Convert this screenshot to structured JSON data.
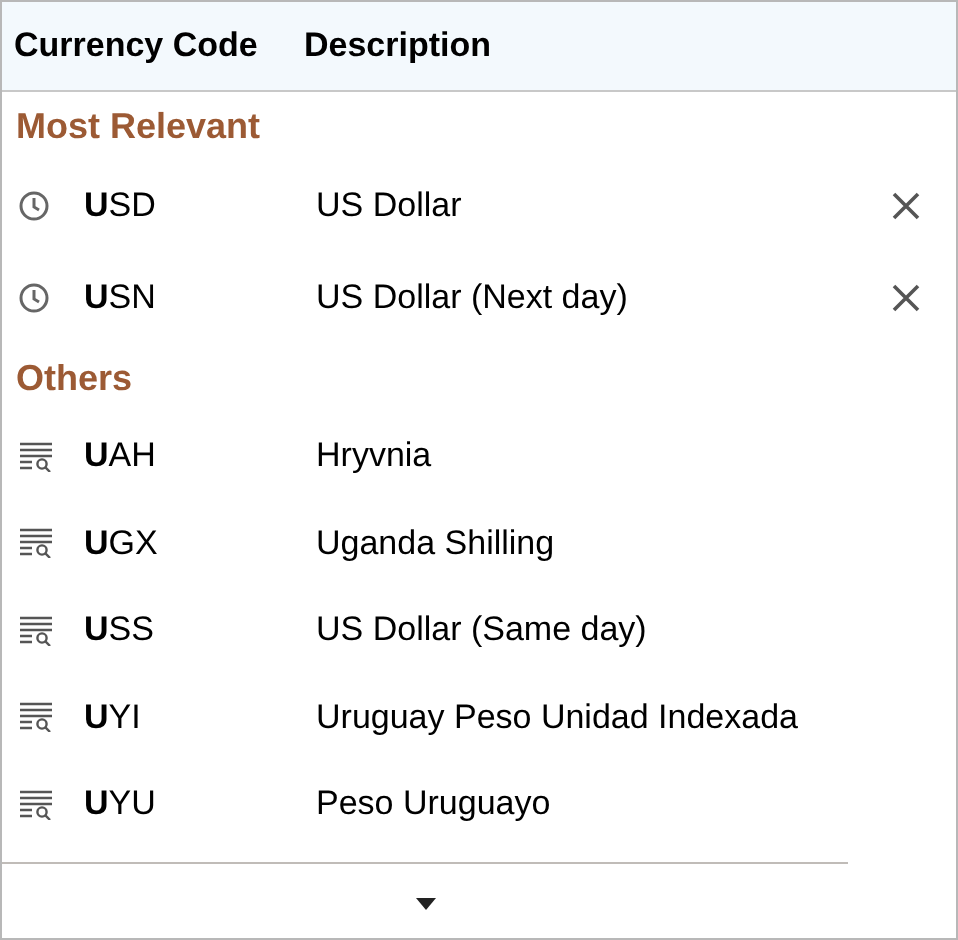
{
  "columns": [
    "Currency Code",
    "Description"
  ],
  "groups": [
    {
      "title": "Most Relevant",
      "items": [
        {
          "kind": "recent",
          "code": "**U**SD",
          "description": "US Dollar"
        },
        {
          "kind": "recent",
          "code": "**U**SN",
          "description": "US Dollar (Next day)"
        }
      ]
    },
    {
      "title": "Others",
      "items": [
        {
          "kind": "result",
          "code": "**U**AH",
          "description": "Hryvnia"
        },
        {
          "kind": "result",
          "code": "**U**GX",
          "description": "Uganda Shilling"
        },
        {
          "kind": "result",
          "code": "**U**SS",
          "description": "US Dollar (Same day)"
        },
        {
          "kind": "result",
          "code": "**U**YI",
          "description": "Uruguay Peso Unidad Indexada"
        },
        {
          "kind": "result",
          "code": "**U**YU",
          "description": "Peso Uruguayo"
        }
      ]
    }
  ]
}
